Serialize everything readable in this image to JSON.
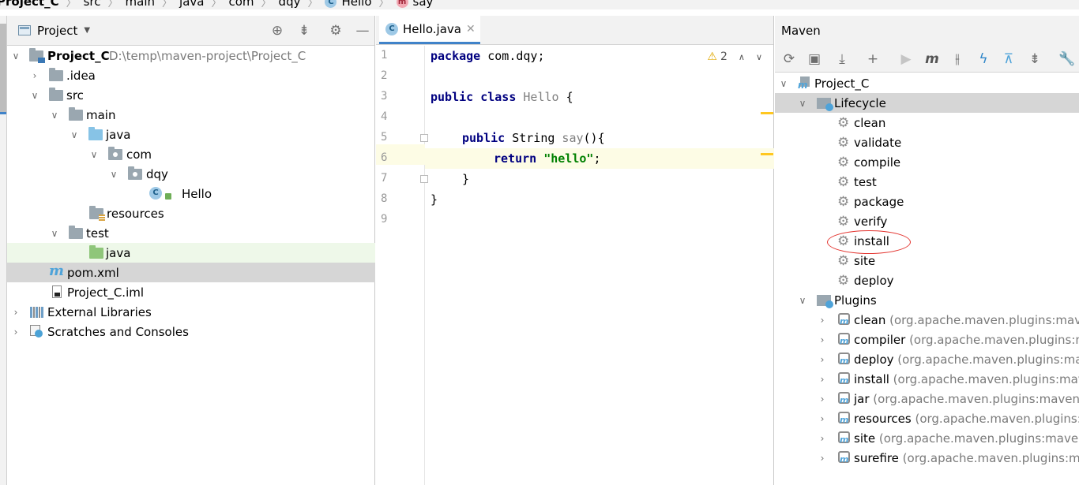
{
  "breadcrumb": [
    "Project_C",
    "src",
    "main",
    "java",
    "com",
    "dqy",
    "Hello",
    "say"
  ],
  "project_panel": {
    "title": "Project",
    "tree": [
      {
        "label": "Project_C",
        "path": "D:\\temp\\maven-project\\Project_C"
      },
      {
        "label": ".idea"
      },
      {
        "label": "src"
      },
      {
        "label": "main"
      },
      {
        "label": "java"
      },
      {
        "label": "com"
      },
      {
        "label": "dqy"
      },
      {
        "label": "Hello"
      },
      {
        "label": "resources"
      },
      {
        "label": "test"
      },
      {
        "label": "java"
      },
      {
        "label": "pom.xml"
      },
      {
        "label": "Project_C.iml"
      },
      {
        "label": "External Libraries"
      },
      {
        "label": "Scratches and Consoles"
      }
    ]
  },
  "editor": {
    "tab_label": "Hello.java",
    "warning_count": "2",
    "line_numbers": [
      "1",
      "2",
      "3",
      "4",
      "5",
      "6",
      "7",
      "8",
      "9"
    ],
    "code": {
      "l1_kw": "package",
      "l1_rest": " com.dqy;",
      "l3_kw": "public class",
      "l3_name": " Hello",
      "l3_rest": " {",
      "l5_kw": "public",
      "l5_type": " String",
      "l5_name": " say",
      "l5_rest": "(){",
      "l6_kw": "return",
      "l6_str": " \"hello\"",
      "l6_rest": ";",
      "l7": "}",
      "l8": "}"
    }
  },
  "maven": {
    "title": "Maven",
    "project": "Project_C",
    "lifecycle_label": "Lifecycle",
    "phases": [
      "clean",
      "validate",
      "compile",
      "test",
      "package",
      "verify",
      "install",
      "site",
      "deploy"
    ],
    "plugins_label": "Plugins",
    "plugins": [
      {
        "name": "clean",
        "desc": " (org.apache.maven.plugins:maven"
      },
      {
        "name": "compiler",
        "desc": " (org.apache.maven.plugins:ma"
      },
      {
        "name": "deploy",
        "desc": " (org.apache.maven.plugins:mav"
      },
      {
        "name": "install",
        "desc": " (org.apache.maven.plugins:mave"
      },
      {
        "name": "jar",
        "desc": " (org.apache.maven.plugins:maven-ja"
      },
      {
        "name": "resources",
        "desc": " (org.apache.maven.plugins:m"
      },
      {
        "name": "site",
        "desc": " (org.apache.maven.plugins:maven-"
      },
      {
        "name": "surefire",
        "desc": " (org.apache.maven.plugins:ma"
      }
    ]
  }
}
